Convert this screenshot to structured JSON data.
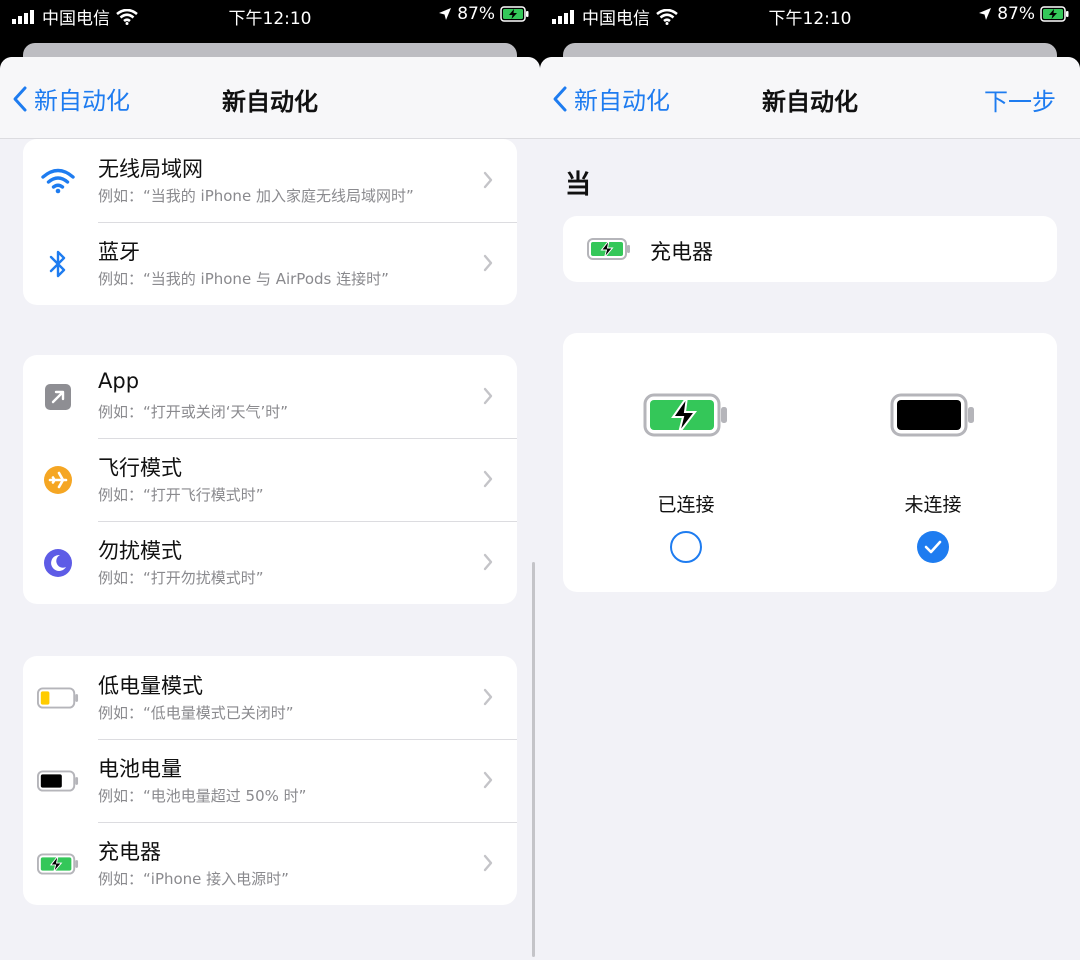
{
  "status_bar": {
    "carrier": "中国电信",
    "time": "下午12:10",
    "battery": "87%"
  },
  "colors": {
    "accent": "#1e7cf0",
    "charge_green": "#34c759",
    "low_power_yellow": "#ffcc00",
    "airplane_orange": "#f5a623",
    "dnd_purple": "#5e5ce6"
  },
  "left": {
    "nav": {
      "back_label": "新自动化",
      "title": "新自动化"
    },
    "groups": [
      {
        "items": [
          {
            "icon": "wifi-icon",
            "title": "无线局域网",
            "subtitle": "例如：“当我的 iPhone 加入家庭无线局域网时”"
          },
          {
            "icon": "bluetooth-icon",
            "title": "蓝牙",
            "subtitle": "例如：“当我的 iPhone 与 AirPods 连接时”"
          }
        ]
      },
      {
        "items": [
          {
            "icon": "app-icon",
            "title": "App",
            "subtitle": "例如：“打开或关闭‘天气’时”"
          },
          {
            "icon": "airplane-icon",
            "title": "飞行模式",
            "subtitle": "例如：“打开飞行模式时”"
          },
          {
            "icon": "moon-icon",
            "title": "勿扰模式",
            "subtitle": "例如：“打开勿扰模式时”"
          }
        ]
      },
      {
        "items": [
          {
            "icon": "low-battery-icon",
            "title": "低电量模式",
            "subtitle": "例如：“低电量模式已关闭时”"
          },
          {
            "icon": "battery-icon",
            "title": "电池电量",
            "subtitle": "例如：“电池电量超过 50% 时”"
          },
          {
            "icon": "charging-battery-icon",
            "title": "充电器",
            "subtitle": "例如：“iPhone 接入电源时”"
          }
        ]
      }
    ]
  },
  "right": {
    "nav": {
      "back_label": "新自动化",
      "title": "新自动化",
      "next_label": "下一步"
    },
    "section_label": "当",
    "trigger": {
      "icon": "charging-battery-icon",
      "label": "充电器"
    },
    "options": [
      {
        "icon": "charging-battery-icon",
        "label": "已连接",
        "selected": false
      },
      {
        "icon": "battery-icon",
        "label": "未连接",
        "selected": true
      }
    ]
  }
}
